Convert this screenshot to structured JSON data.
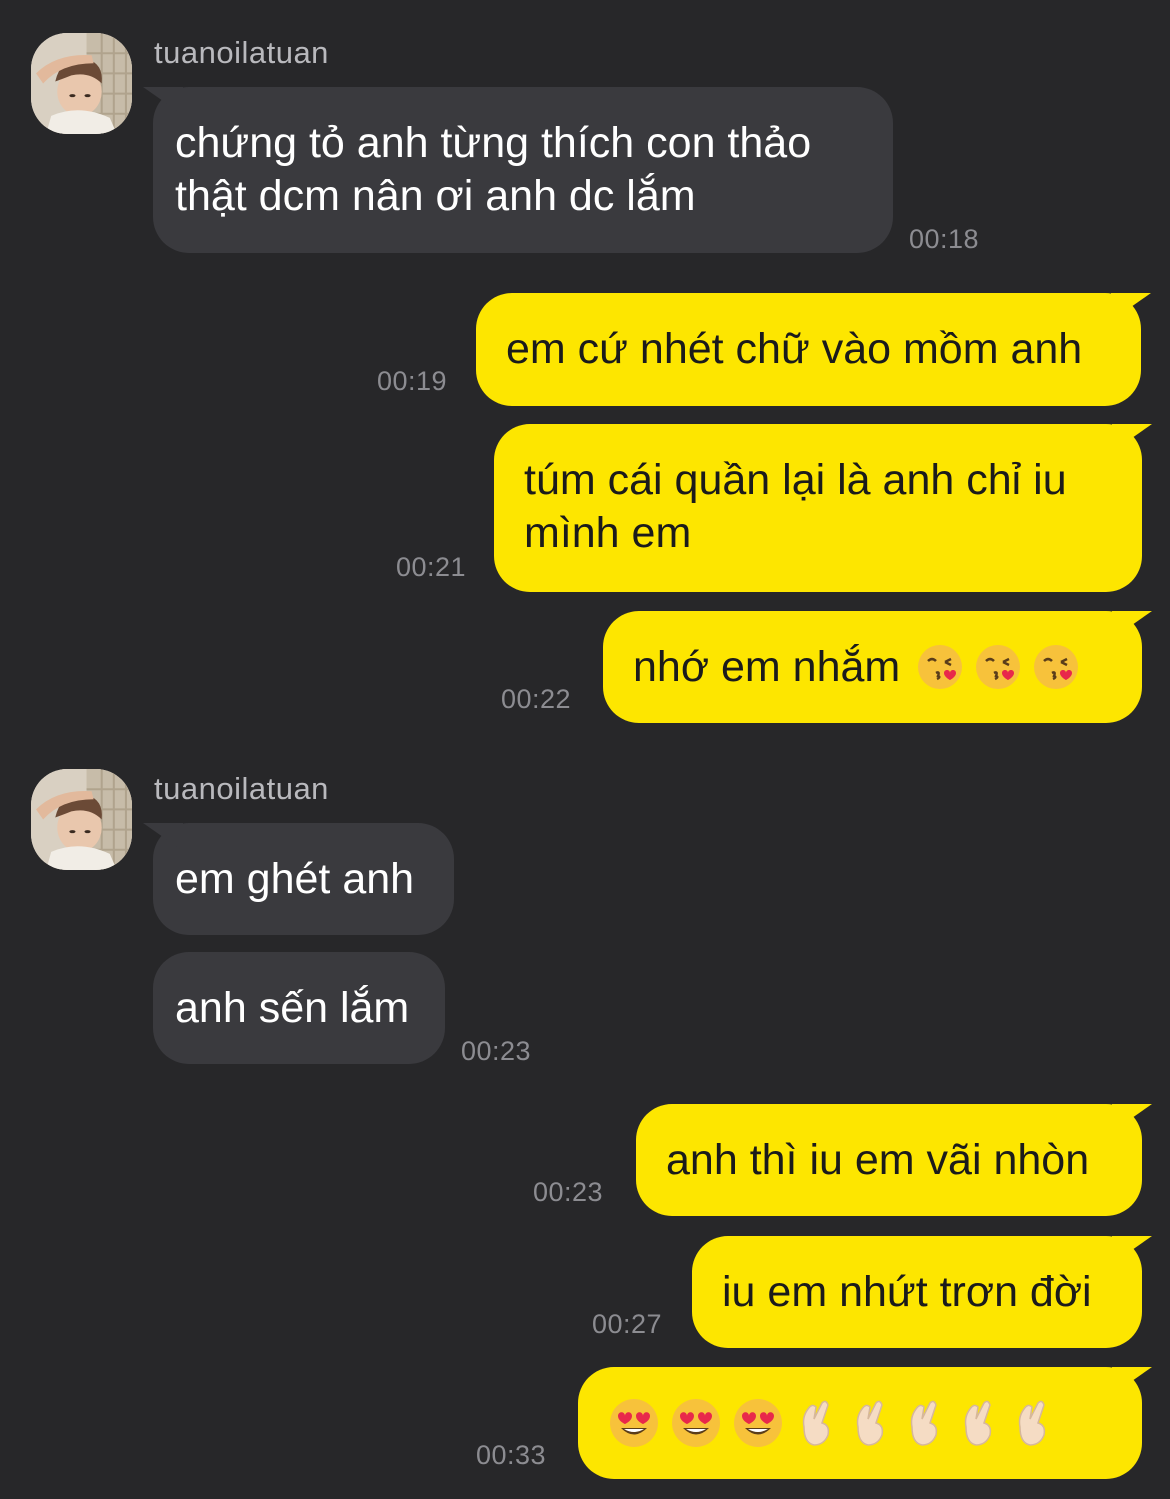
{
  "conversation": {
    "contact_name": "tuanoilatuan",
    "messages": [
      {
        "text_line1": "chứng tỏ anh từng thích con thảo",
        "text_line2": "thật dcm nân ơi anh dc lắm",
        "time": "00:18"
      },
      {
        "text": "em cứ nhét chữ vào mồm anh",
        "time": "00:19"
      },
      {
        "text_line1": "túm cái quần lại là anh chỉ iu",
        "text_line2": "mình em",
        "time": "00:21"
      },
      {
        "text": "nhớ em nhắm",
        "emoji": [
          "kissing-heart",
          "kissing-heart",
          "kissing-heart"
        ],
        "time": "00:22"
      },
      {
        "text": "em ghét anh"
      },
      {
        "text": "anh sến lắm",
        "time": "00:23"
      },
      {
        "text": "anh thì iu em vãi nhòn",
        "time": "00:23"
      },
      {
        "text": "iu em nhứt trơn đời",
        "time": "00:27"
      },
      {
        "emoji": [
          "heart-eyes",
          "heart-eyes",
          "heart-eyes",
          "crossed-fingers",
          "crossed-fingers",
          "crossed-fingers",
          "crossed-fingers",
          "crossed-fingers"
        ],
        "time": "00:33"
      }
    ]
  },
  "colors": {
    "background": "#272729",
    "incoming_bubble": "#3a3a3e",
    "outgoing_bubble": "#fde600",
    "timestamp": "#8c8c91"
  }
}
